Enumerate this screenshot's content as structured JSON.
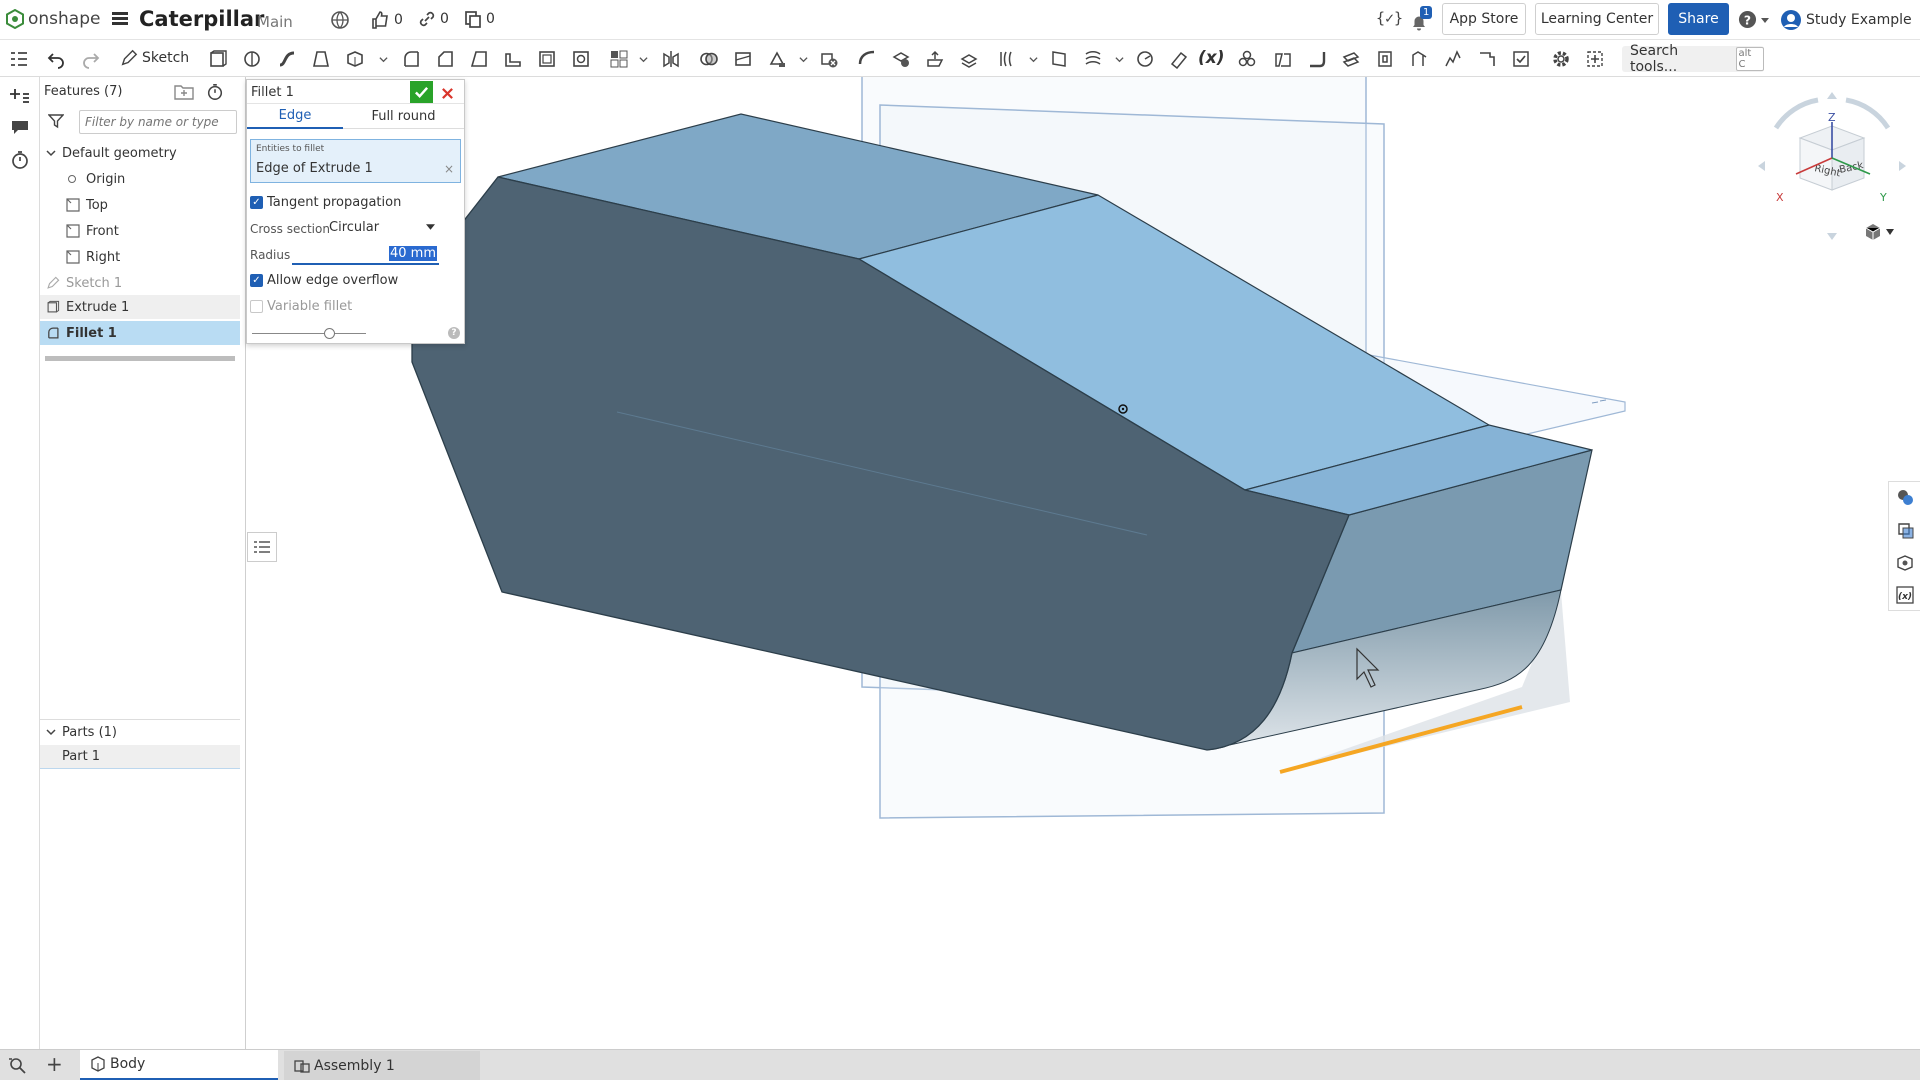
{
  "topbar": {
    "brand": "onshape",
    "doc_title": "Caterpillar",
    "workspace": "Main",
    "likes": "0",
    "links": "0",
    "copies": "0",
    "notif_count": "1",
    "app_store": "App Store",
    "learning_center": "Learning Center",
    "share": "Share",
    "user": "Study Example"
  },
  "toolbar": {
    "sketch_label": "Sketch",
    "search_label": "Search tools...",
    "search_shortcut": "alt C"
  },
  "features": {
    "title": "Features (7)",
    "filter_placeholder": "Filter by name or type",
    "default_geometry": "Default geometry",
    "origin": "Origin",
    "top": "Top",
    "front": "Front",
    "right": "Right",
    "sketch1": "Sketch 1",
    "extrude1": "Extrude 1",
    "fillet1": "Fillet 1"
  },
  "parts": {
    "title": "Parts (1)",
    "part1": "Part 1"
  },
  "dialog": {
    "title": "Fillet 1",
    "tab_edge": "Edge",
    "tab_full_round": "Full round",
    "entities_label": "Entities to fillet",
    "entities_value": "Edge of Extrude 1",
    "tangent_propagation": "Tangent propagation",
    "cross_section_label": "Cross section",
    "cross_section_value": "Circular",
    "radius_label": "Radius",
    "radius_value": "40 mm",
    "allow_overflow": "Allow edge overflow",
    "variable_fillet": "Variable fillet"
  },
  "viewcube": {
    "axis_z": "Z",
    "axis_x": "X",
    "axis_y": "Y",
    "face_right": "Right",
    "face_back": "Back"
  },
  "bottom": {
    "tab_body": "Body",
    "tab_assembly": "Assembly 1"
  },
  "colors": {
    "accent_blue": "#1f5fb4",
    "part_top": "#8fbfdf",
    "part_side_dark": "#4e6373",
    "selected_edge": "#f5a623",
    "confirm_green": "#29a329",
    "cancel_red": "#d9352b"
  }
}
